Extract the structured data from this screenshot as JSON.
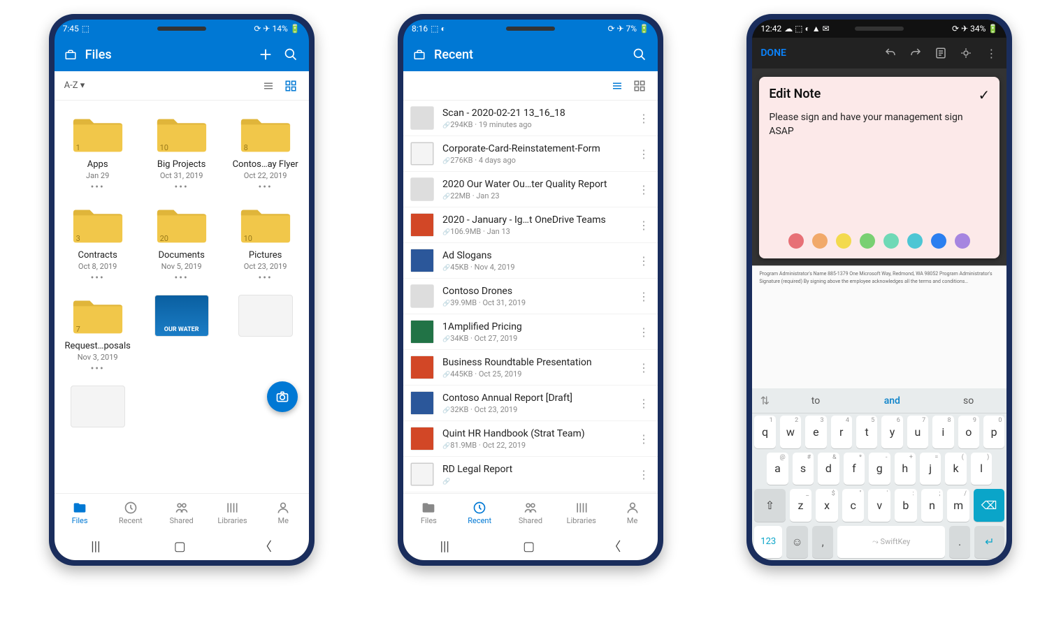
{
  "phone1": {
    "status": {
      "time": "7:45",
      "indicators": "⟳ ✈ 14% 🔋"
    },
    "header": {
      "title": "Files"
    },
    "sort": "A-Z",
    "folders": [
      {
        "name": "Apps",
        "date": "Jan 29",
        "count": "1"
      },
      {
        "name": "Big Projects",
        "date": "Oct 31, 2019",
        "count": "10"
      },
      {
        "name": "Contos…ay Flyer",
        "date": "Oct 22, 2019",
        "count": "8"
      },
      {
        "name": "Contracts",
        "date": "Oct 8, 2019",
        "count": "3"
      },
      {
        "name": "Documents",
        "date": "Nov 5, 2019",
        "count": "20"
      },
      {
        "name": "Pictures",
        "date": "Oct 23, 2019",
        "count": "10"
      },
      {
        "name": "Request…posals",
        "date": "Nov 3, 2019",
        "count": "7"
      }
    ],
    "thumbs": [
      "OUR WATER",
      "",
      ""
    ],
    "nav": [
      "Files",
      "Recent",
      "Shared",
      "Libraries",
      "Me"
    ],
    "nav_active": 0
  },
  "phone2": {
    "status": {
      "time": "8:16",
      "indicators": "⟳ ✈ 7% 🔋"
    },
    "header": {
      "title": "Recent"
    },
    "files": [
      {
        "name": "Scan - 2020-02-21 13_16_18",
        "meta": "294KB · 19 minutes ago",
        "icon": "img"
      },
      {
        "name": "Corporate-Card-Reinstatement-Form",
        "meta": "276KB · 4 days ago",
        "icon": "doc"
      },
      {
        "name": "2020 Our Water Ou…ter Quality Report",
        "meta": "22MB · Jan 23",
        "icon": "img"
      },
      {
        "name": "2020 - January - Ig…t OneDrive Teams",
        "meta": "106.9MB · Jan 13",
        "icon": "ppt"
      },
      {
        "name": "Ad Slogans",
        "meta": "45KB · Nov 4, 2019",
        "icon": "word"
      },
      {
        "name": "Contoso Drones",
        "meta": "39.9MB · Oct 31, 2019",
        "icon": "img"
      },
      {
        "name": "1Amplified Pricing",
        "meta": "34KB · Oct 27, 2019",
        "icon": "xls"
      },
      {
        "name": "Business Roundtable Presentation",
        "meta": "445KB · Oct 25, 2019",
        "icon": "ppt"
      },
      {
        "name": "Contoso Annual Report [Draft]",
        "meta": "32KB · Oct 23, 2019",
        "icon": "word"
      },
      {
        "name": "Quint HR Handbook (Strat Team)",
        "meta": "81.9MB · Oct 22, 2019",
        "icon": "ppt"
      },
      {
        "name": "RD Legal Report",
        "meta": "",
        "icon": "doc"
      }
    ],
    "nav": [
      "Files",
      "Recent",
      "Shared",
      "Libraries",
      "Me"
    ],
    "nav_active": 1
  },
  "phone3": {
    "status": {
      "time": "12:42",
      "indicators": "⟳ ✈ 34% 🔋"
    },
    "toolbar": {
      "done": "DONE"
    },
    "note": {
      "title": "Edit Note",
      "body": "Please sign and have your management sign ASAP",
      "colors": [
        "#e77076",
        "#f1a96a",
        "#f3da4e",
        "#79d072",
        "#6fd9b6",
        "#4dc6d4",
        "#2b7ff0",
        "#a685e0"
      ]
    },
    "doc_preview": "Program Administrator's Name          885-1379\nOne Microsoft Way, Redmond, WA 98052\nProgram Administrator's Signature (required)\nBy signing above the employee acknowledges all the terms and conditions…",
    "suggestions": [
      "to",
      "and",
      "so"
    ],
    "keyboard": {
      "row1": [
        {
          "k": "q",
          "a": "1"
        },
        {
          "k": "w",
          "a": "2"
        },
        {
          "k": "e",
          "a": "3"
        },
        {
          "k": "r",
          "a": "4"
        },
        {
          "k": "t",
          "a": "5"
        },
        {
          "k": "y",
          "a": "6"
        },
        {
          "k": "u",
          "a": "7"
        },
        {
          "k": "i",
          "a": "8"
        },
        {
          "k": "o",
          "a": "9"
        },
        {
          "k": "p",
          "a": "0"
        }
      ],
      "row2": [
        {
          "k": "a",
          "a": "@"
        },
        {
          "k": "s",
          "a": "#"
        },
        {
          "k": "d",
          "a": "&"
        },
        {
          "k": "f",
          "a": "*"
        },
        {
          "k": "g",
          "a": "-"
        },
        {
          "k": "h",
          "a": "+"
        },
        {
          "k": "j",
          "a": "="
        },
        {
          "k": "k",
          "a": "("
        },
        {
          "k": "l",
          "a": ")"
        }
      ],
      "row3": [
        {
          "k": "z",
          "a": "_"
        },
        {
          "k": "x",
          "a": "$"
        },
        {
          "k": "c",
          "a": "\""
        },
        {
          "k": "v",
          "a": "'"
        },
        {
          "k": "b",
          "a": ":"
        },
        {
          "k": "n",
          "a": ";"
        },
        {
          "k": "m",
          "a": "/"
        }
      ],
      "sym": "123",
      "space": "SwiftKey"
    }
  }
}
